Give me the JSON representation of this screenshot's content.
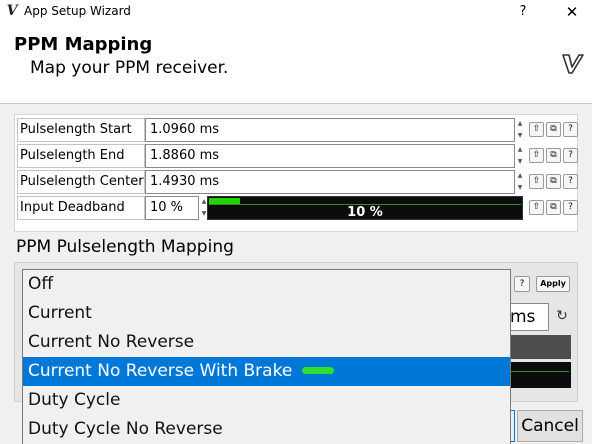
{
  "window": {
    "title": "App Setup Wizard",
    "help_label": "?",
    "close_label": "✕"
  },
  "header": {
    "title": "PPM Mapping",
    "subtitle": "Map your PPM receiver."
  },
  "params": [
    {
      "label": "Pulselength Start",
      "value": "1.0960 ms"
    },
    {
      "label": "Pulselength End",
      "value": "1.8860 ms"
    },
    {
      "label": "Pulselength Center",
      "value": "1.4930 ms"
    }
  ],
  "deadband": {
    "label": "Input Deadband",
    "value": "10 %",
    "bar_text": "10 %",
    "fraction": 0.1
  },
  "tool_icons": {
    "upload": "⇧",
    "copy": "⧉",
    "help": "?"
  },
  "mapping": {
    "section_title": "PPM Pulselength Mapping",
    "apply_label": "Apply",
    "help_label": "?",
    "ms_value": "ms",
    "refresh_icon": "↻"
  },
  "dropdown": {
    "options": [
      {
        "label": "Off",
        "selected": false
      },
      {
        "label": "Current",
        "selected": false
      },
      {
        "label": "Current No Reverse",
        "selected": false
      },
      {
        "label": "Current No Reverse With Brake",
        "selected": true
      },
      {
        "label": "Duty Cycle",
        "selected": false
      },
      {
        "label": "Duty Cycle No Reverse",
        "selected": false
      }
    ]
  },
  "buttons": {
    "cancel_label": "Cancel"
  },
  "colors": {
    "selection": "#0078d7",
    "bar_green": "#21d300",
    "bar_background": "#0c0c0c"
  }
}
